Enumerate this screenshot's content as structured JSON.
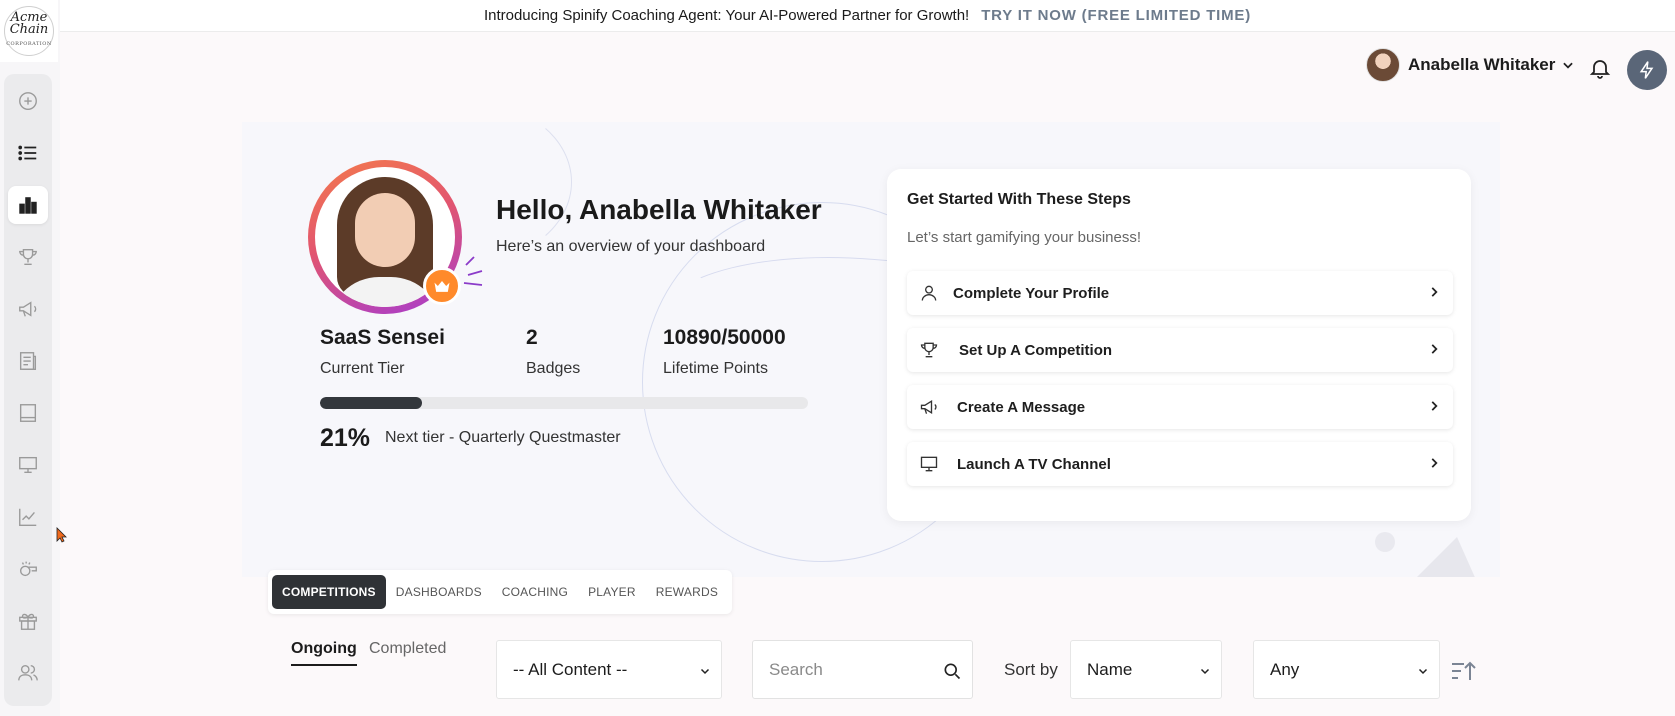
{
  "announcement": {
    "message": "Introducing Spinify Coaching Agent: Your AI-Powered Partner for Growth!",
    "cta": "TRY IT NOW (FREE LIMITED TIME)"
  },
  "logo": {
    "line1": "Acme",
    "line2": "Chain",
    "line3": "CORPORATION"
  },
  "sidebar": {
    "items": [
      {
        "name": "sidebar-item-add",
        "icon": "plus-circle-icon"
      },
      {
        "name": "sidebar-item-list",
        "icon": "list-icon"
      },
      {
        "name": "sidebar-item-dashboard",
        "icon": "bar-chart-icon",
        "active": true
      },
      {
        "name": "sidebar-item-competitions",
        "icon": "trophy-icon"
      },
      {
        "name": "sidebar-item-messages",
        "icon": "megaphone-icon"
      },
      {
        "name": "sidebar-item-reports",
        "icon": "document-icon"
      },
      {
        "name": "sidebar-item-library",
        "icon": "book-icon"
      },
      {
        "name": "sidebar-item-tv",
        "icon": "monitor-icon"
      },
      {
        "name": "sidebar-item-analytics",
        "icon": "line-chart-icon"
      },
      {
        "name": "sidebar-item-coaching",
        "icon": "whistle-icon"
      },
      {
        "name": "sidebar-item-rewards",
        "icon": "gift-icon"
      },
      {
        "name": "sidebar-item-users",
        "icon": "users-icon"
      }
    ]
  },
  "header": {
    "user_name": "Anabella Whitaker"
  },
  "hero": {
    "greeting": "Hello, Anabella Whitaker",
    "subtitle": "Here’s an overview of your dashboard",
    "tier": {
      "value": "SaaS Sensei",
      "label": "Current Tier"
    },
    "badges": {
      "value": "2",
      "label": "Badges"
    },
    "points": {
      "value": "10890/50000",
      "label": "Lifetime Points"
    },
    "progress_percent": 21,
    "progress_text": "21%",
    "next_tier": "Next tier - Quarterly Questmaster"
  },
  "steps": {
    "title": "Get Started With These Steps",
    "subtitle": "Let’s start gamifying your business!",
    "items": [
      {
        "label": "Complete Your Profile",
        "icon": "user-icon"
      },
      {
        "label": "Set Up A Competition",
        "icon": "trophy-icon"
      },
      {
        "label": "Create A Message",
        "icon": "megaphone-icon"
      },
      {
        "label": "Launch A TV Channel",
        "icon": "monitor-icon"
      }
    ]
  },
  "tabs": [
    "COMPETITIONS",
    "DASHBOARDS",
    "COACHING",
    "PLAYER",
    "REWARDS"
  ],
  "filters": {
    "subtabs": [
      "Ongoing",
      "Completed"
    ],
    "content_select": "-- All Content --",
    "search_placeholder": "Search",
    "sort_label": "Sort by",
    "sort_select": "Name",
    "any_select": "Any"
  },
  "colors": {
    "accent_dark": "#2f3236",
    "bolt_button": "#5a6678",
    "crown_badge": "#ff8a2b",
    "cta_text": "#6d7b8c"
  }
}
